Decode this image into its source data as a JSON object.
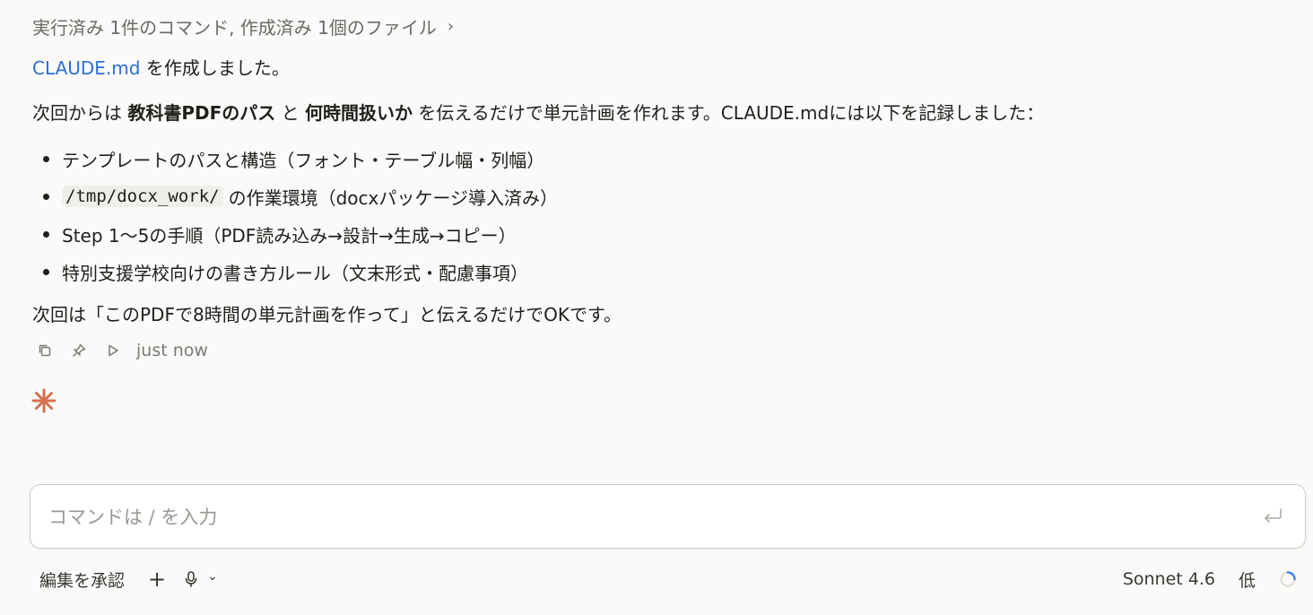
{
  "summary": {
    "text": "実行済み 1件のコマンド, 作成済み 1個のファイル",
    "chevron": "›"
  },
  "message": {
    "created_file": "CLAUDE.md",
    "created_suffix": " を作成しました。",
    "intro_1": "次回からは ",
    "intro_bold_1": "教科書PDFのパス",
    "intro_2": " と ",
    "intro_bold_2": "何時間扱いか",
    "intro_3": " を伝えるだけで単元計画を作れます。CLAUDE.mdには以下を記録しました：",
    "bullets": [
      "テンプレートのパスと構造（フォント・テーブル幅・列幅）",
      "の作業環境（docxパッケージ導入済み）",
      "Step 1〜5の手順（PDF読み込み→設計→生成→コピー）",
      "特別支援学校向けの書き方ルール（文末形式・配慮事項）"
    ],
    "bullet_code": "/tmp/docx_work/",
    "closing": "次回は「このPDFで8時間の単元計画を作って」と伝えるだけでOKです。"
  },
  "actions": {
    "copy_icon": "copy-icon",
    "pin_icon": "pin-icon",
    "play_icon": "play-icon",
    "timestamp": "just now"
  },
  "input": {
    "placeholder": "コマンドは / を入力",
    "value": ""
  },
  "bottom_bar": {
    "accept_edits": "編集を承認",
    "add": "+",
    "mic_chevron": "⌄",
    "model": "Sonnet 4.6",
    "effort": "低"
  },
  "colors": {
    "background": "#fbfaf8",
    "link": "#2b6fd6",
    "spark": "#d4714f",
    "muted": "#6b6a66"
  }
}
